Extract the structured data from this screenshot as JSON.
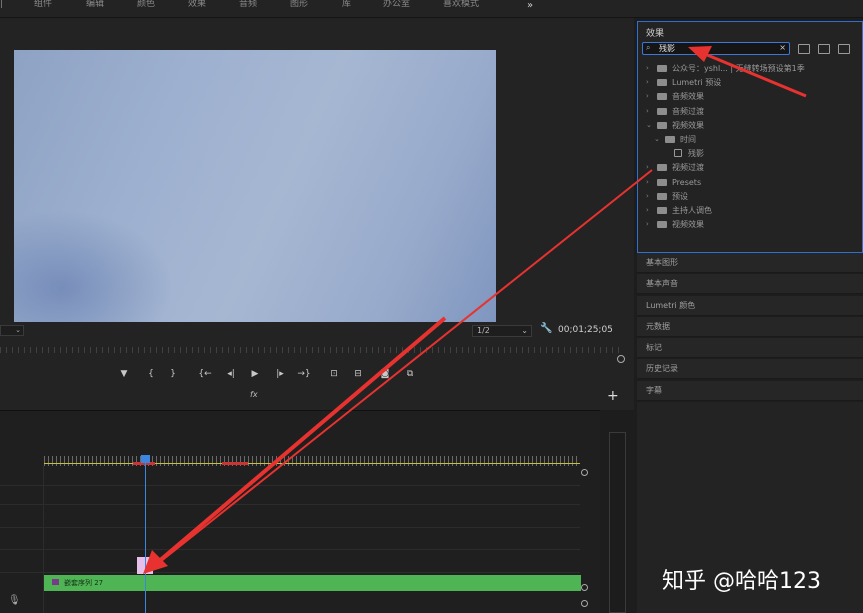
{
  "menu": {
    "tabs": [
      "组件",
      "编辑",
      "颜色",
      "效果",
      "音频",
      "图形",
      "库",
      "办公室",
      "喜欢模式"
    ],
    "overflow": "»"
  },
  "program_monitor": {
    "zoom_left": "",
    "resolution": "1/2",
    "timecode": "00;01;25;05",
    "fx_label": "fx",
    "add_button": "+"
  },
  "transport": {
    "buttons": [
      "marker-icon",
      "in-point-icon",
      "out-point-icon",
      "go-to-in-icon",
      "step-back-icon",
      "play-icon",
      "step-forward-icon",
      "go-to-out-icon",
      "lift-icon",
      "extract-icon",
      "export-frame-icon",
      "compare-icon"
    ],
    "glyphs": [
      "▼",
      "{",
      "}",
      "{←",
      "◂|",
      "▶",
      "|▸",
      "→}",
      "⊡",
      "⊟",
      "◙",
      "⧉"
    ]
  },
  "effects_panel": {
    "title": "效果",
    "search_value": "残影",
    "tree": [
      {
        "label": "公众号：yshl... | 无缝转场预设第1季",
        "level": 0,
        "expanded": false,
        "type": "bin"
      },
      {
        "label": "Lumetri 预设",
        "level": 0,
        "expanded": false,
        "type": "bin"
      },
      {
        "label": "音频效果",
        "level": 0,
        "expanded": false,
        "type": "folder"
      },
      {
        "label": "音频过渡",
        "level": 0,
        "expanded": false,
        "type": "folder"
      },
      {
        "label": "视频效果",
        "level": 0,
        "expanded": true,
        "type": "bin"
      },
      {
        "label": "时间",
        "level": 1,
        "expanded": true,
        "type": "folder"
      },
      {
        "label": "残影",
        "level": 2,
        "expanded": false,
        "type": "effect"
      },
      {
        "label": "视频过渡",
        "level": 0,
        "expanded": false,
        "type": "folder"
      },
      {
        "label": "Presets",
        "level": 0,
        "expanded": false,
        "type": "folder"
      },
      {
        "label": "预设",
        "level": 0,
        "expanded": false,
        "type": "bin"
      },
      {
        "label": "主持人调色",
        "level": 0,
        "expanded": false,
        "type": "folder"
      },
      {
        "label": "视频效果",
        "level": 0,
        "expanded": false,
        "type": "folder"
      }
    ]
  },
  "side_panels": [
    "基本图形",
    "基本声音",
    "Lumetri 颜色",
    "元数据",
    "标记",
    "历史记录",
    "字幕"
  ],
  "timeline": {
    "clip_label": "嵌套序列 27"
  },
  "watermark": "知乎 @哈哈123",
  "colors": {
    "accent_blue": "#2e6fd1",
    "clip_green": "#4fb453",
    "arrow_red": "#e8322f"
  }
}
